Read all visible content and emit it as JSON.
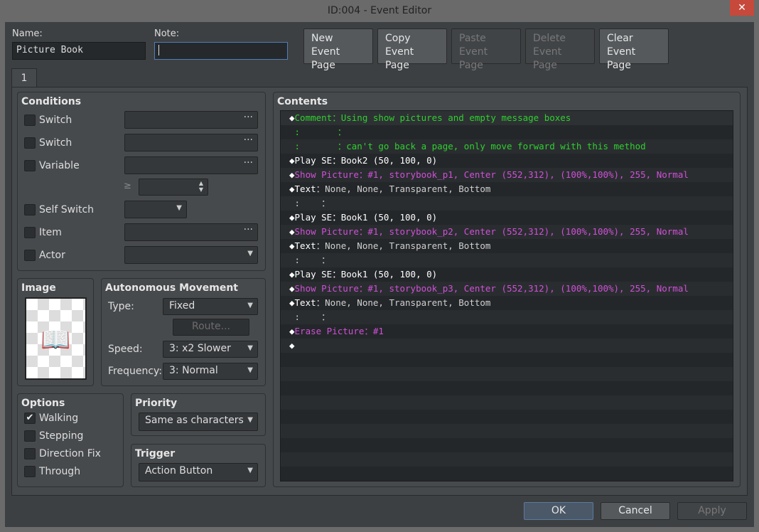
{
  "window": {
    "title": "ID:004 - Event Editor",
    "close": "✕"
  },
  "name": {
    "label": "Name:",
    "value": "Picture Book"
  },
  "note": {
    "label": "Note:",
    "value": ""
  },
  "page_buttons": [
    {
      "line1": "New",
      "line2": "Event Page",
      "enabled": true
    },
    {
      "line1": "Copy",
      "line2": "Event Page",
      "enabled": true
    },
    {
      "line1": "Paste",
      "line2": "Event Page",
      "enabled": false
    },
    {
      "line1": "Delete",
      "line2": "Event Page",
      "enabled": false
    },
    {
      "line1": "Clear",
      "line2": "Event Page",
      "enabled": true
    }
  ],
  "tabs": [
    "1"
  ],
  "conditions": {
    "title": "Conditions",
    "items": [
      {
        "label": "Switch",
        "checked": false
      },
      {
        "label": "Switch",
        "checked": false
      },
      {
        "label": "Variable",
        "checked": false
      },
      {
        "label": "Self Switch",
        "checked": false
      },
      {
        "label": "Item",
        "checked": false
      },
      {
        "label": "Actor",
        "checked": false
      }
    ],
    "ge": "≥",
    "dots": "···"
  },
  "image": {
    "title": "Image"
  },
  "movement": {
    "title": "Autonomous Movement",
    "type_label": "Type:",
    "type": "Fixed",
    "route": "Route...",
    "speed_label": "Speed:",
    "speed": "3: x2 Slower",
    "freq_label": "Frequency:",
    "freq": "3: Normal"
  },
  "options": {
    "title": "Options",
    "items": [
      {
        "label": "Walking",
        "checked": true
      },
      {
        "label": "Stepping",
        "checked": false
      },
      {
        "label": "Direction Fix",
        "checked": false
      },
      {
        "label": "Through",
        "checked": false
      }
    ]
  },
  "priority": {
    "title": "Priority",
    "value": "Same as characters"
  },
  "trigger": {
    "title": "Trigger",
    "value": "Action Button"
  },
  "contents": {
    "title": "Contents",
    "colors": {
      "comment": "#2ed12e",
      "picture": "#d050d8",
      "white": "#ffffff",
      "param": "#cfcfcf"
    },
    "lines": [
      [
        [
          "◆",
          "white"
        ],
        [
          "Comment",
          "comment"
        ],
        [
          "：Using show pictures and empty message boxes",
          "comment"
        ]
      ],
      [
        [
          " :       ：",
          "comment"
        ]
      ],
      [
        [
          " :       ：can't go back a page, only move forward with this method",
          "comment"
        ]
      ],
      [
        [
          "◆",
          "white"
        ],
        [
          "Play SE",
          "white"
        ],
        [
          "：Book2 (50, 100, 0)",
          "white"
        ]
      ],
      [
        [
          "◆",
          "white"
        ],
        [
          "Show Picture：#1, storybook_p1, Center (552,312), (100%,100%), 255, Normal",
          "picture"
        ]
      ],
      [
        [
          "◆",
          "white"
        ],
        [
          "Text",
          "white"
        ],
        [
          "：None, None, Transparent, Bottom",
          "param"
        ]
      ],
      [
        [
          " :    ：",
          "param"
        ]
      ],
      [
        [
          "◆",
          "white"
        ],
        [
          "Play SE",
          "white"
        ],
        [
          "：Book1 (50, 100, 0)",
          "white"
        ]
      ],
      [
        [
          "◆",
          "white"
        ],
        [
          "Show Picture：#1, storybook_p2, Center (552,312), (100%,100%), 255, Normal",
          "picture"
        ]
      ],
      [
        [
          "◆",
          "white"
        ],
        [
          "Text",
          "white"
        ],
        [
          "：None, None, Transparent, Bottom",
          "param"
        ]
      ],
      [
        [
          " :    ：",
          "param"
        ]
      ],
      [
        [
          "◆",
          "white"
        ],
        [
          "Play SE",
          "white"
        ],
        [
          "：Book1 (50, 100, 0)",
          "white"
        ]
      ],
      [
        [
          "◆",
          "white"
        ],
        [
          "Show Picture：#1, storybook_p3, Center (552,312), (100%,100%), 255, Normal",
          "picture"
        ]
      ],
      [
        [
          "◆",
          "white"
        ],
        [
          "Text",
          "white"
        ],
        [
          "：None, None, Transparent, Bottom",
          "param"
        ]
      ],
      [
        [
          " :    ：",
          "param"
        ]
      ],
      [
        [
          "◆",
          "white"
        ],
        [
          "Erase Picture：#1",
          "picture"
        ]
      ],
      [
        [
          "◆",
          "white"
        ]
      ]
    ]
  },
  "footer": {
    "ok": "OK",
    "cancel": "Cancel",
    "apply": "Apply"
  }
}
